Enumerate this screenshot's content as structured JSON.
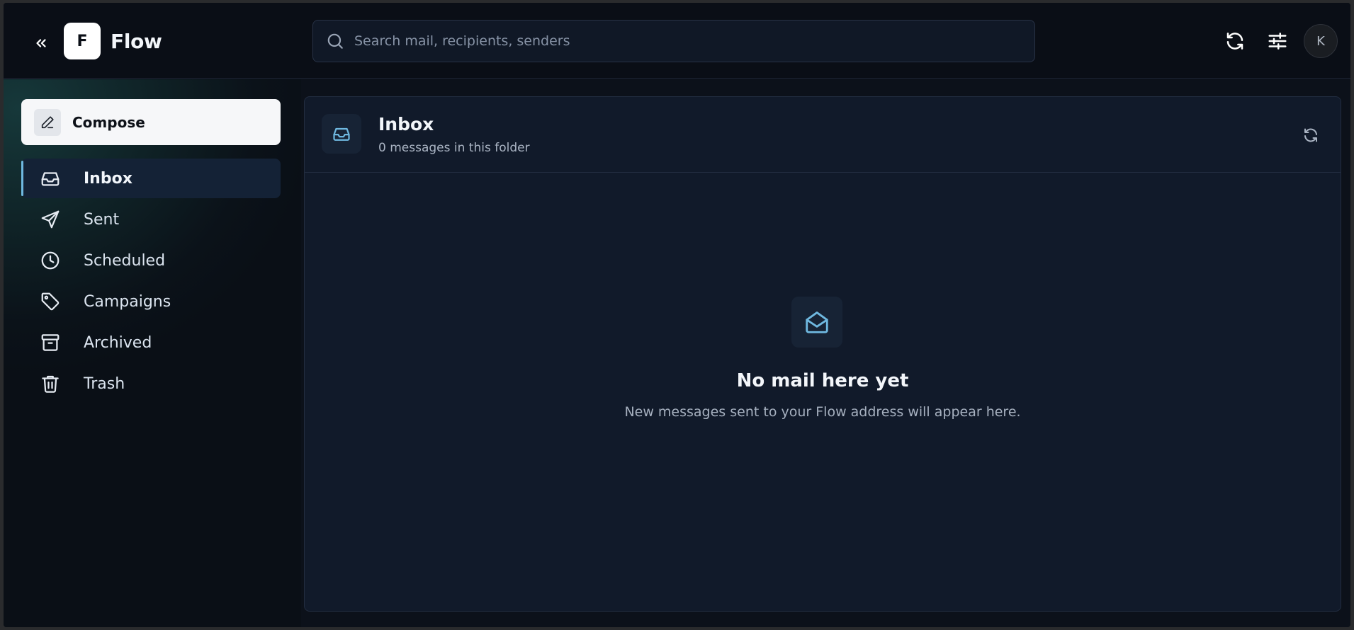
{
  "header": {
    "logo_letter": "F",
    "app_name": "Flow",
    "search_placeholder": "Search mail, recipients, senders",
    "avatar_initial": "K",
    "icons": {
      "collapse": "double-chevron-left-icon",
      "search": "search-icon",
      "refresh": "refresh-icon",
      "settings": "sliders-icon"
    }
  },
  "sidebar": {
    "compose_label": "Compose",
    "items": [
      {
        "label": "Inbox",
        "icon": "inbox-icon",
        "active": true
      },
      {
        "label": "Sent",
        "icon": "send-icon",
        "active": false
      },
      {
        "label": "Scheduled",
        "icon": "clock-icon",
        "active": false
      },
      {
        "label": "Campaigns",
        "icon": "tag-icon",
        "active": false
      },
      {
        "label": "Archived",
        "icon": "archive-icon",
        "active": false
      },
      {
        "label": "Trash",
        "icon": "trash-icon",
        "active": false
      }
    ]
  },
  "main": {
    "folder_title": "Inbox",
    "folder_subtitle": "0 messages in this folder",
    "empty_title": "No mail here yet",
    "empty_subtitle": "New messages sent to your Flow address will appear here."
  },
  "colors": {
    "accent": "#6fb8e0",
    "background": "#0c111a",
    "panel": "#111a2a"
  }
}
